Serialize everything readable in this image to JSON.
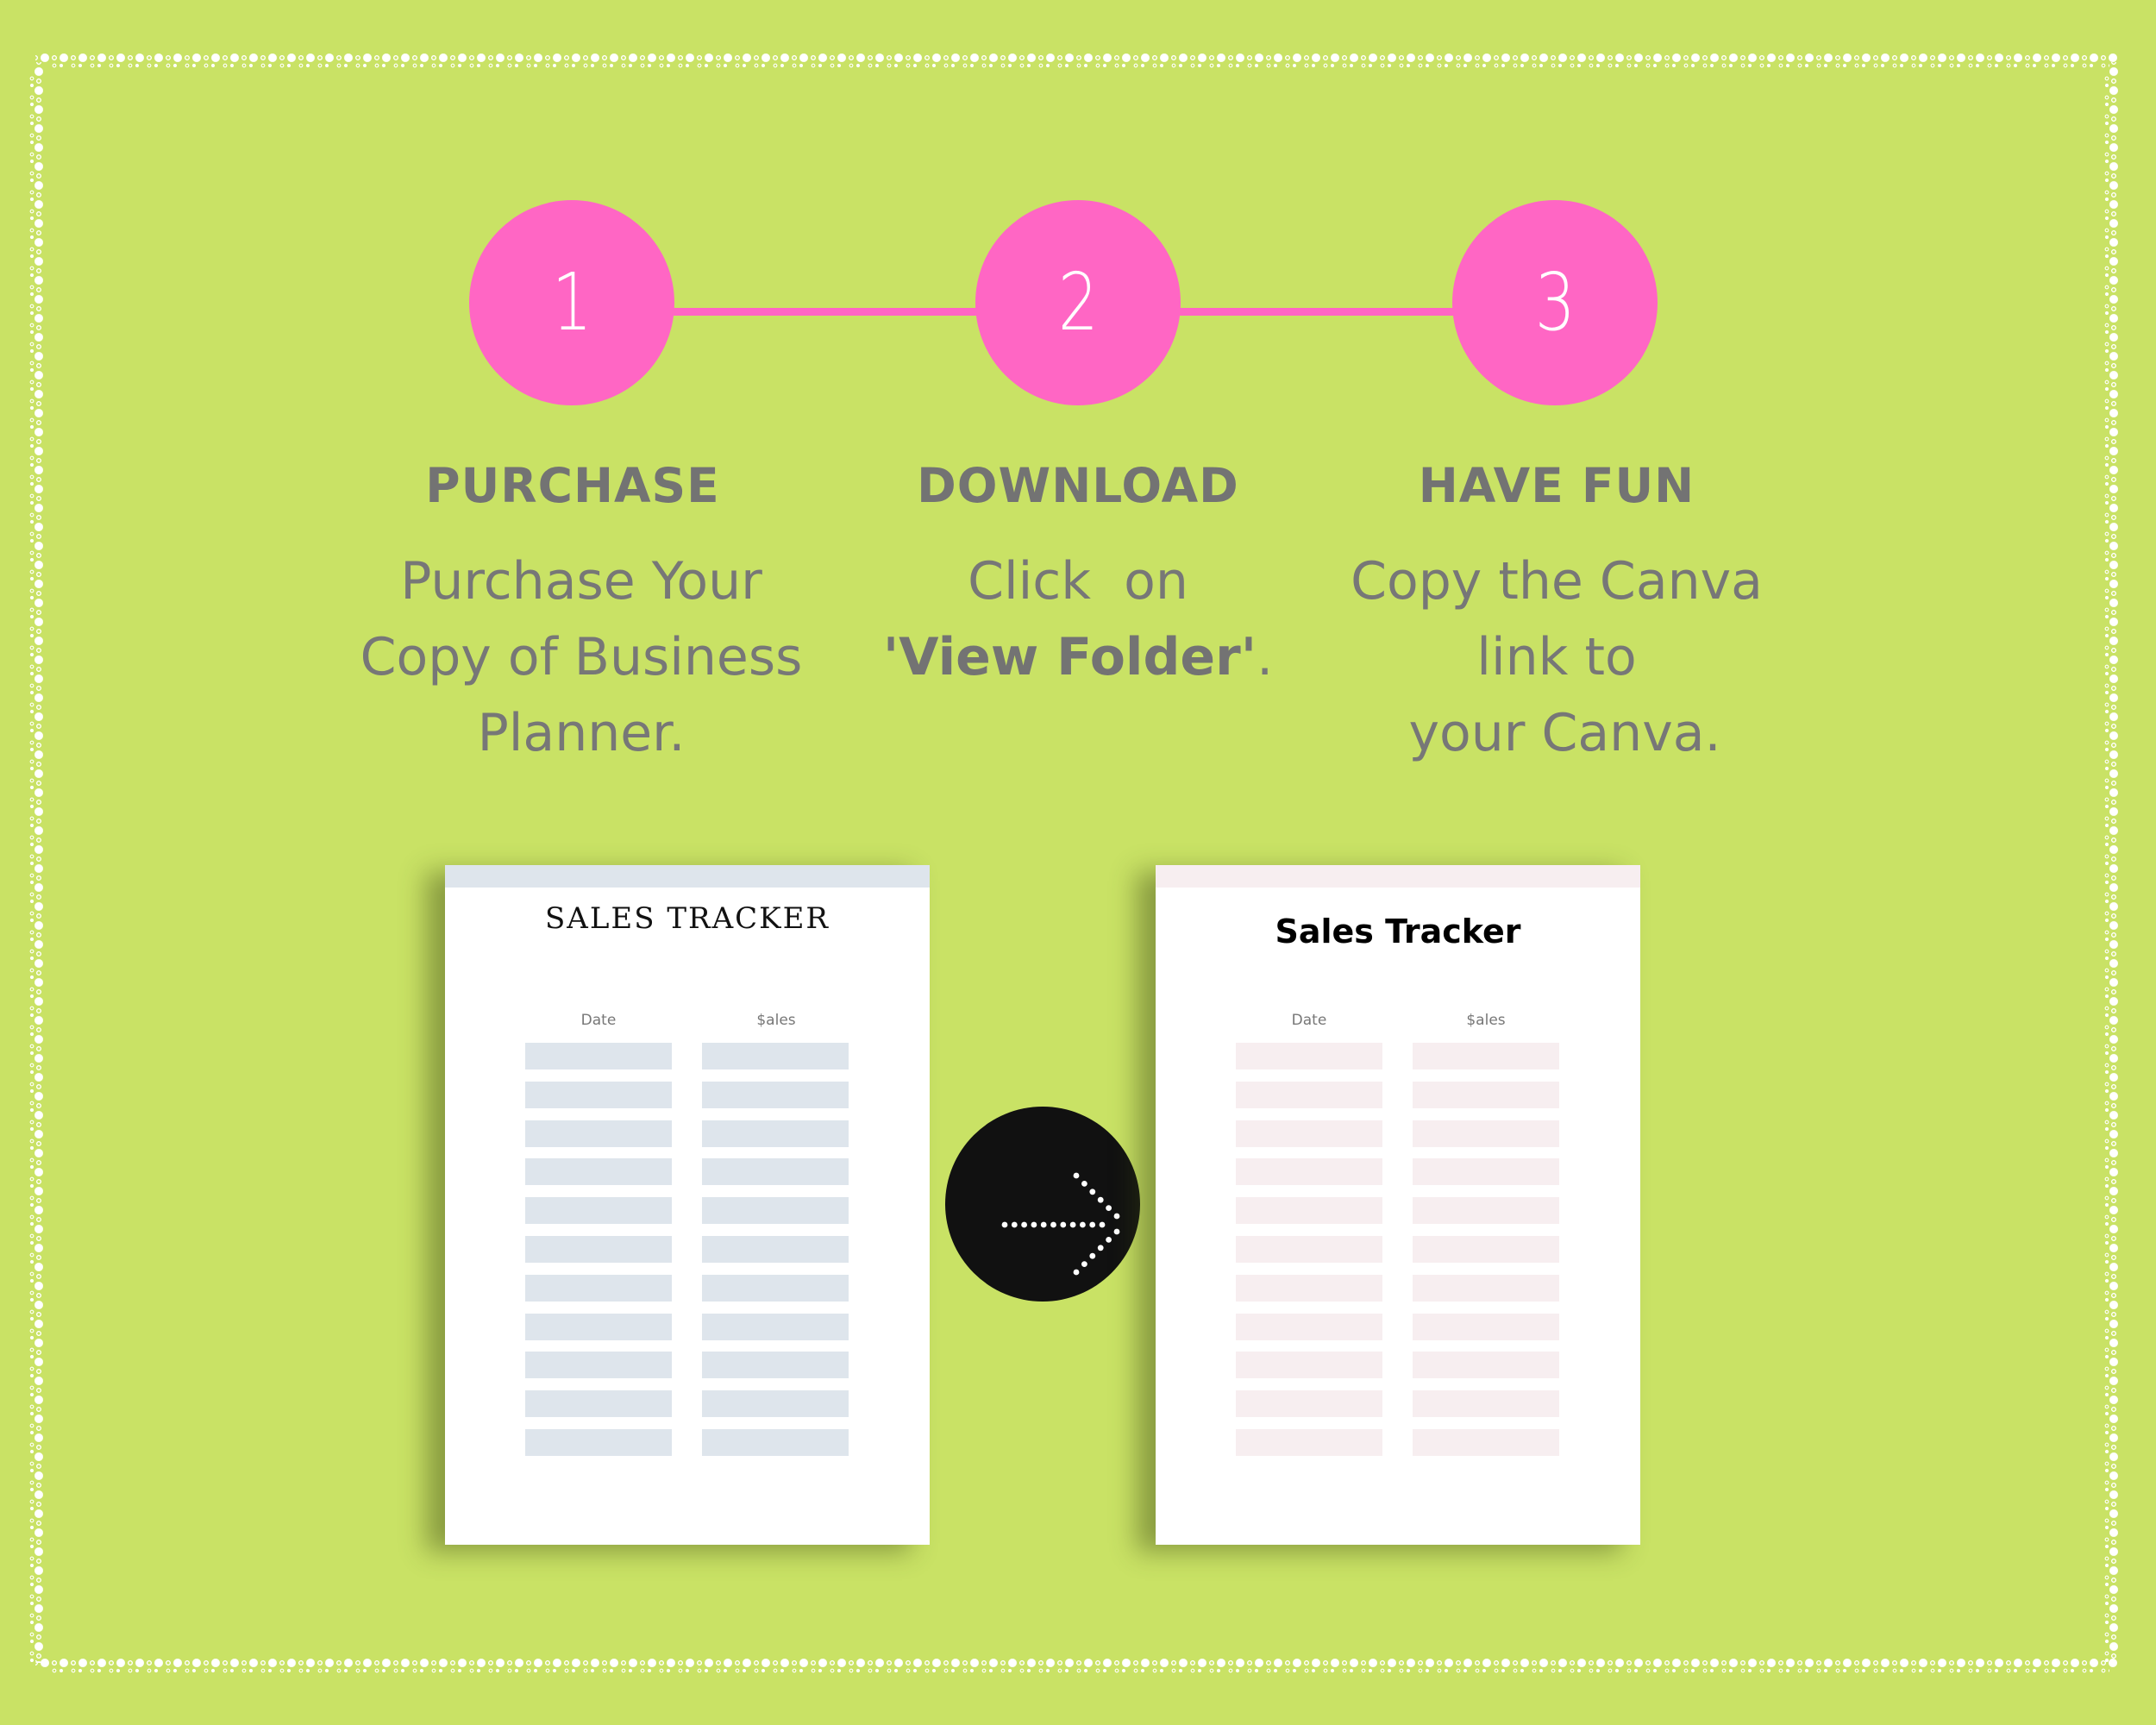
{
  "colors": {
    "background": "#C9E265",
    "accent": "#FF66C4",
    "text": "#737373",
    "blue_template": "#DEE5EC",
    "pink_template": "#F7EEF0",
    "arrow_circle": "#111111"
  },
  "steps": [
    {
      "number": "1",
      "title": "PURCHASE",
      "body_lines": [
        "Purchase Your",
        "Copy of Business",
        "Planner."
      ]
    },
    {
      "number": "2",
      "title": "DOWNLOAD",
      "body_lines": [
        "Click  on"
      ],
      "body_bold": "'View Folder'",
      "body_tail": "."
    },
    {
      "number": "3",
      "title": "HAVE FUN",
      "body_lines": [
        "Copy the Canva",
        "link to",
        " your Canva."
      ]
    }
  ],
  "templates": {
    "before": {
      "title": "SALES TRACKER",
      "columns": [
        "Date",
        "$ales"
      ],
      "row_count": 11
    },
    "after": {
      "title": "Sales Tracker",
      "columns": [
        "Date",
        "$ales"
      ],
      "row_count": 11
    },
    "transition_icon": "dotted-arrow-right-icon"
  }
}
